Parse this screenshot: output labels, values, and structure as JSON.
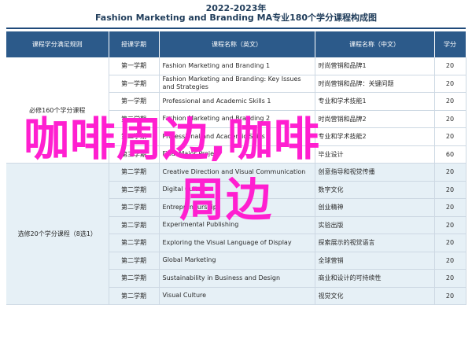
{
  "header": {
    "year": "2022-2023年",
    "title": "Fashion Marketing and Branding MA专业180个学分课程构成图"
  },
  "columns": [
    "课程学分满足规则",
    "授课学期",
    "课程名称（英文）",
    "课程名称（中文）",
    "学分"
  ],
  "groups": {
    "required": "必修160个学分课程",
    "elective": "选修20个学分课程（8选1）"
  },
  "required_rows": [
    {
      "semester": "第一学期",
      "en": "Fashion Marketing and Branding 1",
      "cn": "时尚营销和品牌1",
      "credits": "20"
    },
    {
      "semester": "第一学期",
      "en": "Fashion Marketing and Branding: Key Issues and Strategies",
      "cn": "时尚营销和品牌：关键问题",
      "credits": "20"
    },
    {
      "semester": "第一学期",
      "en": "Professional and Academic Skills 1",
      "cn": "专业和学术技能1",
      "credits": "20"
    },
    {
      "semester": "第二学期",
      "en": "Fashion Marketing and Branding 2",
      "cn": "时尚营销和品牌2",
      "credits": "20"
    },
    {
      "semester": "第二学期",
      "en": "Professional and Academic Skills 2",
      "cn": "专业和学术技能2",
      "credits": "20"
    },
    {
      "semester": "第三学期",
      "en": "Final Major Project",
      "cn": "毕业设计",
      "credits": "60"
    }
  ],
  "elective_rows": [
    {
      "semester": "第二学期",
      "en": "Creative Direction and Visual Communication",
      "cn": "创意指导和视觉传播",
      "credits": "20"
    },
    {
      "semester": "第二学期",
      "en": "Digital Culture",
      "cn": "数字文化",
      "credits": "20"
    },
    {
      "semester": "第二学期",
      "en": "Entrepreneurship",
      "cn": "创业精神",
      "credits": "20"
    },
    {
      "semester": "第二学期",
      "en": "Experimental Publishing",
      "cn": "实验出版",
      "credits": "20"
    },
    {
      "semester": "第二学期",
      "en": "Exploring the Visual Language of Display",
      "cn": "探索展示的视觉语言",
      "credits": "20"
    },
    {
      "semester": "第二学期",
      "en": "Global Marketing",
      "cn": "全球营销",
      "credits": "20"
    },
    {
      "semester": "第二学期",
      "en": "Sustainability in Business and Design",
      "cn": "商业和设计的可持续性",
      "credits": "20"
    },
    {
      "semester": "第二学期",
      "en": "Visual Culture",
      "cn": "视觉文化",
      "credits": "20"
    }
  ],
  "watermark": {
    "line1": "咖啡周边,咖啡",
    "line2": "周边",
    "color": "#ff1fd0"
  }
}
